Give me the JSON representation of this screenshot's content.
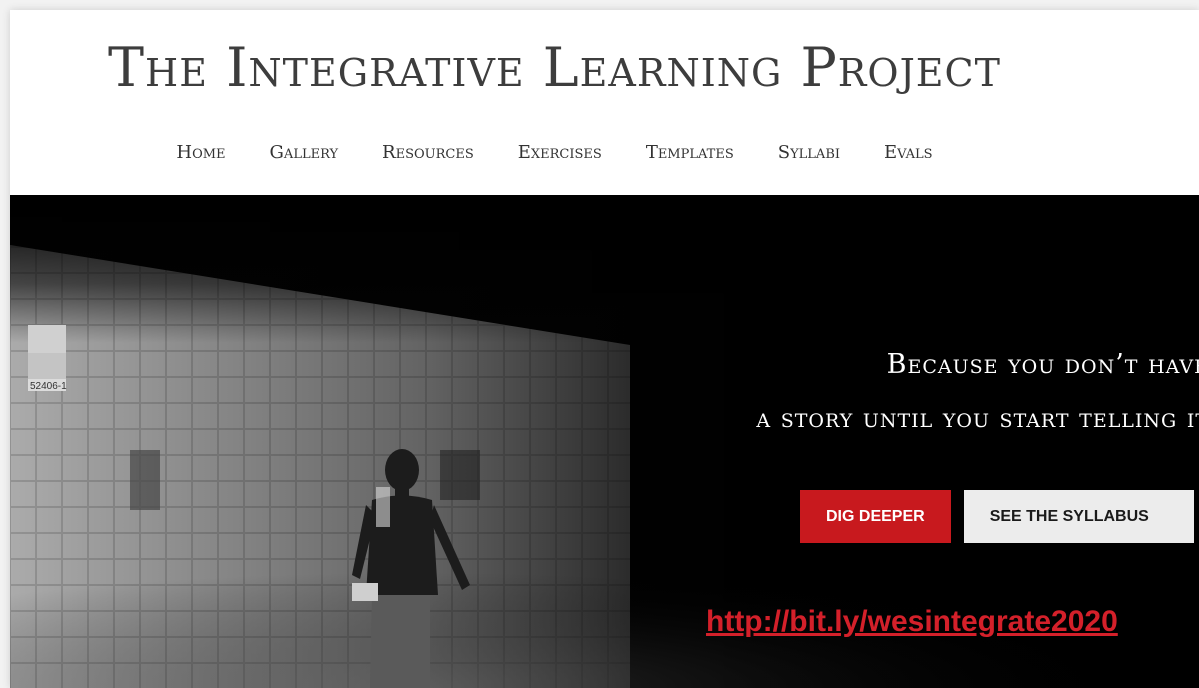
{
  "site": {
    "title": "The Integrative Learning Project"
  },
  "nav": {
    "items": [
      {
        "label": "Home"
      },
      {
        "label": "Gallery"
      },
      {
        "label": "Resources"
      },
      {
        "label": "Exercises"
      },
      {
        "label": "Templates"
      },
      {
        "label": "Syllabi"
      },
      {
        "label": "Evals"
      }
    ]
  },
  "hero": {
    "tagline_line1": "Because you don’t have",
    "tagline_line2": "a story until you start telling it",
    "primary_button": "DIG DEEPER",
    "secondary_button": "SEE THE SYLLABUS",
    "overlay_link": "http://bit.ly/wesintegrate2020",
    "wall_sign_number": "52406-1"
  },
  "colors": {
    "accent_red": "#c8191e",
    "link_red": "#d4202a",
    "title_gray": "#3d3d3d"
  }
}
